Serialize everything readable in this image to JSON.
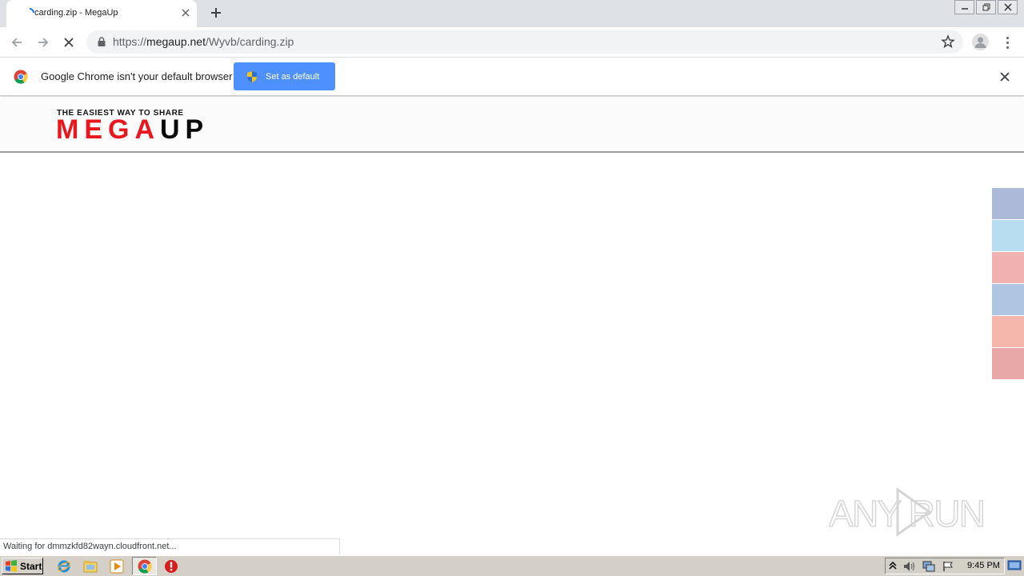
{
  "browser": {
    "tab": {
      "title": "carding.zip - MegaUp"
    },
    "address": {
      "scheme": "https://",
      "host": "megaup.net",
      "path": "/Wyvb/carding.zip"
    }
  },
  "infobar": {
    "message": "Google Chrome isn't your default browser",
    "button_label": "Set as default"
  },
  "site": {
    "logo": {
      "tagline": "THE EASIEST WAY TO SHARE",
      "word_red": "MEGA",
      "word_black": "UP"
    }
  },
  "sidebar_swatches": [
    "#adb9d8",
    "#b8ddf0",
    "#f0b2b0",
    "#afc5e2",
    "#f5b6ab",
    "#e8a8a8"
  ],
  "status": {
    "text": "Waiting for dmmzkfd82wayn.cloudfront.net..."
  },
  "watermark": {
    "text": "ANY RUN"
  },
  "taskbar": {
    "start_label": "Start",
    "clock": "9:45 PM"
  },
  "colors": {
    "accent_blue": "#4d90fe",
    "logo_red": "#e8161d"
  }
}
